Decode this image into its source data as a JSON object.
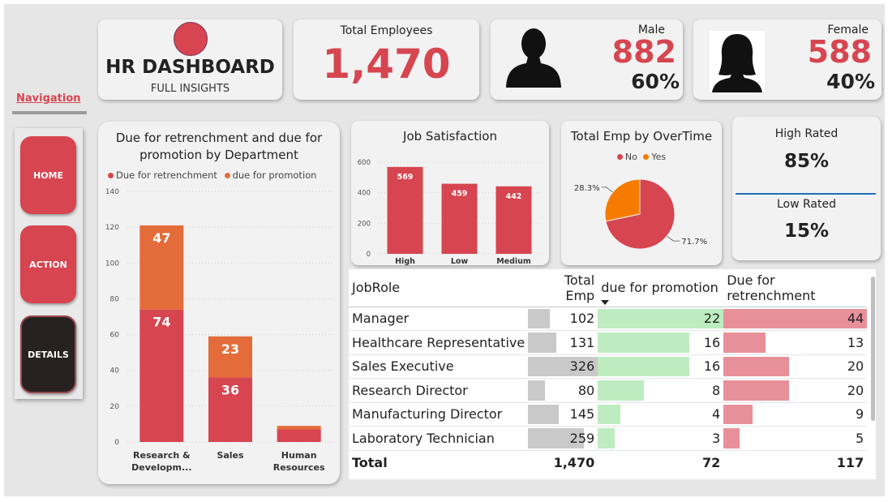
{
  "header": {
    "title": "HR DASHBOARD",
    "subtitle": "FULL INSIGHTS",
    "total_label": "Total Employees",
    "total_value": "1,470",
    "male_label": "Male",
    "male_value": "882",
    "male_pct": "60%",
    "female_label": "Female",
    "female_value": "588",
    "female_pct": "40%"
  },
  "navigation": {
    "label": "Navigation",
    "buttons": [
      "HOME",
      "ACTION",
      "DETAILS"
    ]
  },
  "ratings": {
    "high_label": "High Rated",
    "high_value": "85%",
    "low_label": "Low Rated",
    "low_value": "15%"
  },
  "colors": {
    "red": "#d64550",
    "orange": "#e46c3a",
    "pie_orange": "#f57c00",
    "promo_green": "#bcecc0",
    "retrench_red": "#e8909a",
    "total_gray": "#c9c9c9"
  },
  "icons": {
    "male": "male-silhouette-icon",
    "female": "female-silhouette-icon"
  },
  "chart_data": [
    {
      "type": "bar",
      "stacked": true,
      "title": "Due for retrenchment and due for promotion by Department",
      "categories": [
        "Research & Developm...",
        "Sales",
        "Human Resources"
      ],
      "series": [
        {
          "name": "Due for retrenchment",
          "values": [
            74,
            36,
            7
          ],
          "color": "#d64550"
        },
        {
          "name": "due for promotion",
          "values": [
            47,
            23,
            2
          ],
          "color": "#e46c3a"
        }
      ],
      "ylim": [
        0,
        140
      ],
      "yticks": [
        0,
        20,
        40,
        60,
        80,
        100,
        120,
        140
      ],
      "grid": true,
      "legend": "top-left"
    },
    {
      "type": "bar",
      "title": "Job Satisfaction",
      "categories": [
        "High",
        "Low",
        "Medium"
      ],
      "values": [
        569,
        459,
        442
      ],
      "ylim": [
        0,
        600
      ],
      "yticks": [
        0,
        200,
        400,
        600
      ],
      "grid": true
    },
    {
      "type": "pie",
      "title": "Total Emp by OverTime",
      "categories": [
        "No",
        "Yes"
      ],
      "values": [
        71.7,
        28.3
      ],
      "labels": [
        "71.7%",
        "28.3%"
      ],
      "legend": "top"
    }
  ],
  "table": {
    "columns": [
      "JobRole",
      "Total Emp",
      "due for promotion",
      "Due for retrenchment"
    ],
    "rows": [
      {
        "role": "Manager",
        "total": 102,
        "promo": 22,
        "retrench": 44
      },
      {
        "role": "Healthcare Representative",
        "total": 131,
        "promo": 16,
        "retrench": 13
      },
      {
        "role": "Sales Executive",
        "total": 326,
        "promo": 16,
        "retrench": 20
      },
      {
        "role": "Research Director",
        "total": 80,
        "promo": 8,
        "retrench": 20
      },
      {
        "role": "Manufacturing Director",
        "total": 145,
        "promo": 4,
        "retrench": 9
      },
      {
        "role": "Laboratory Technician",
        "total": 259,
        "promo": 3,
        "retrench": 5
      }
    ],
    "total_row": {
      "label": "Total",
      "total": "1,470",
      "promo": "72",
      "retrench": "117"
    }
  }
}
